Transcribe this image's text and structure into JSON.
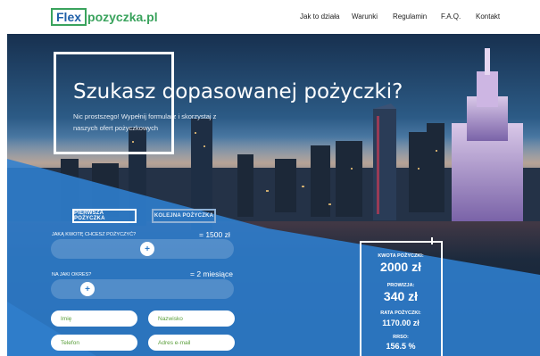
{
  "logo": {
    "part1": "Flex",
    "part2": "pozyczka.pl"
  },
  "nav": [
    "Jak to działa",
    "Warunki",
    "Regulamin",
    "F.A.Q.",
    "Kontakt"
  ],
  "hero": {
    "title": "Szukasz dopasowanej pożyczki?",
    "subtitle": "Nic prostszego! Wypełnij formularz i skorzystaj z naszych ofert pożyczkowych"
  },
  "tabs": [
    "PIERWSZA POŻYCZKA",
    "KOLEJNA POŻYCZKA"
  ],
  "amount": {
    "label": "JAKĄ KWOTĘ CHCESZ POŻYCZYĆ?",
    "value": "= 1500 zł"
  },
  "period": {
    "label": "NA JAKI OKRES?",
    "value": "= 2 miesiące"
  },
  "fields": {
    "name": "Imię",
    "surname": "Nazwisko",
    "phone": "Telefon",
    "email": "Adres e-mail"
  },
  "summary": {
    "amount_label": "KWOTA POŻYCZKI:",
    "amount_value": "2000 zł",
    "fee_label": "PROWIZJA:",
    "fee_value": "340 zł",
    "installment_label": "RATA POŻYCZKI:",
    "installment_value": "1170.00 zł",
    "rrso_label": "RRSO:",
    "rrso_value": "156.5 %"
  },
  "colors": {
    "brand_blue": "#1f5fa8",
    "brand_green": "#3aa35d",
    "panel_blue": "#2f7fd0"
  }
}
